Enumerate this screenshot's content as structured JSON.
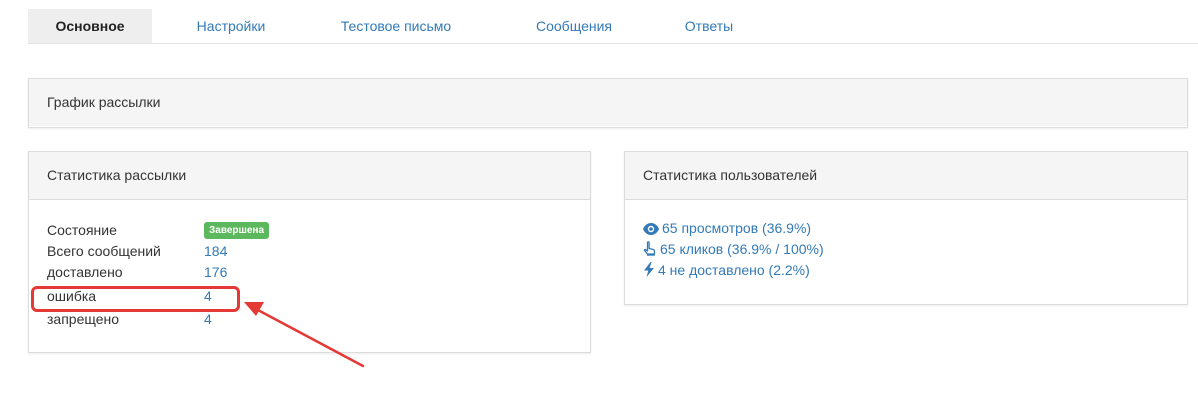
{
  "tabs": [
    {
      "label": "Основное",
      "active": true
    },
    {
      "label": "Настройки",
      "active": false
    },
    {
      "label": "Тестовое письмо",
      "active": false
    },
    {
      "label": "Сообщения",
      "active": false
    },
    {
      "label": "Ответы",
      "active": false
    }
  ],
  "schedule_panel": {
    "title": "График рассылки"
  },
  "mailing_stats": {
    "title": "Статистика рассылки",
    "status_label": "Состояние",
    "status_badge": "Завершена",
    "rows": [
      {
        "label": "Всего сообщений",
        "value": "184"
      },
      {
        "label": "доставлено",
        "value": "176"
      },
      {
        "label": "ошибка",
        "value": "4"
      },
      {
        "label": "запрещено",
        "value": "4"
      }
    ]
  },
  "user_stats": {
    "title": "Статистика пользователей",
    "items": [
      {
        "icon": "eye-icon",
        "text": "65 просмотров (36.9%)"
      },
      {
        "icon": "pointer-hand-icon",
        "text": "65 кликов (36.9% / 100%)"
      },
      {
        "icon": "lightning-icon",
        "text": "4 не доставлено (2.2%)"
      }
    ]
  },
  "colors": {
    "link": "#337ab7",
    "badge_success": "#5cb85c",
    "annotation": "#e53935"
  }
}
